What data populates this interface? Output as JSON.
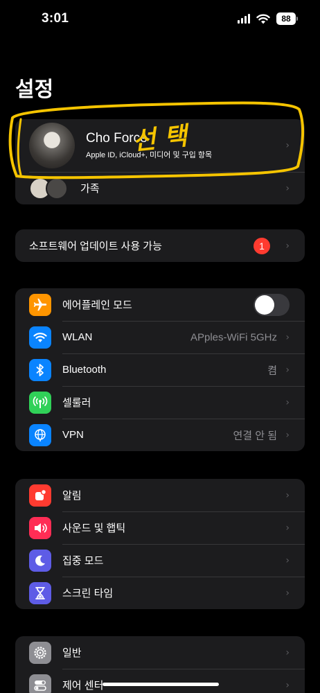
{
  "status_bar": {
    "time": "3:01",
    "battery": "88",
    "icons": [
      "signal-icon",
      "wifi-icon",
      "battery-icon"
    ]
  },
  "page_title": "설정",
  "profile": {
    "name": "Cho Force",
    "subtitle": "Apple ID, iCloud+, 미디어 및 구입 항목"
  },
  "family": {
    "label": "가족"
  },
  "software_update": {
    "label": "소프트웨어 업데이트 사용 가능",
    "badge": "1"
  },
  "connectivity": [
    {
      "label": "에어플레인 모드",
      "icon": "airplane-icon",
      "color": "#ff9500",
      "toggle": false
    },
    {
      "label": "WLAN",
      "value": "APples-WiFi 5GHz",
      "icon": "wifi-icon",
      "color": "#0a84ff"
    },
    {
      "label": "Bluetooth",
      "value": "켬",
      "icon": "bluetooth-icon",
      "color": "#0a84ff"
    },
    {
      "label": "셀룰러",
      "value": "",
      "icon": "cellular-icon",
      "color": "#30d158"
    },
    {
      "label": "VPN",
      "value": "연결 안 됨",
      "icon": "vpn-globe-icon",
      "color": "#0a84ff"
    }
  ],
  "notifications": [
    {
      "label": "알림",
      "icon": "notification-bell-icon",
      "color": "#ff3b30"
    },
    {
      "label": "사운드 및 햅틱",
      "icon": "speaker-icon",
      "color": "#ff2d55"
    },
    {
      "label": "집중 모드",
      "icon": "moon-icon",
      "color": "#5e5ce6"
    },
    {
      "label": "스크린 타임",
      "icon": "hourglass-icon",
      "color": "#5e5ce6"
    }
  ],
  "general": [
    {
      "label": "일반",
      "icon": "gear-icon",
      "color": "#8e8e93"
    },
    {
      "label": "제어 센터",
      "icon": "toggles-icon",
      "color": "#8e8e93"
    }
  ],
  "annotation": {
    "text": "선 택",
    "color": "#f5c400"
  },
  "chevron": "›"
}
